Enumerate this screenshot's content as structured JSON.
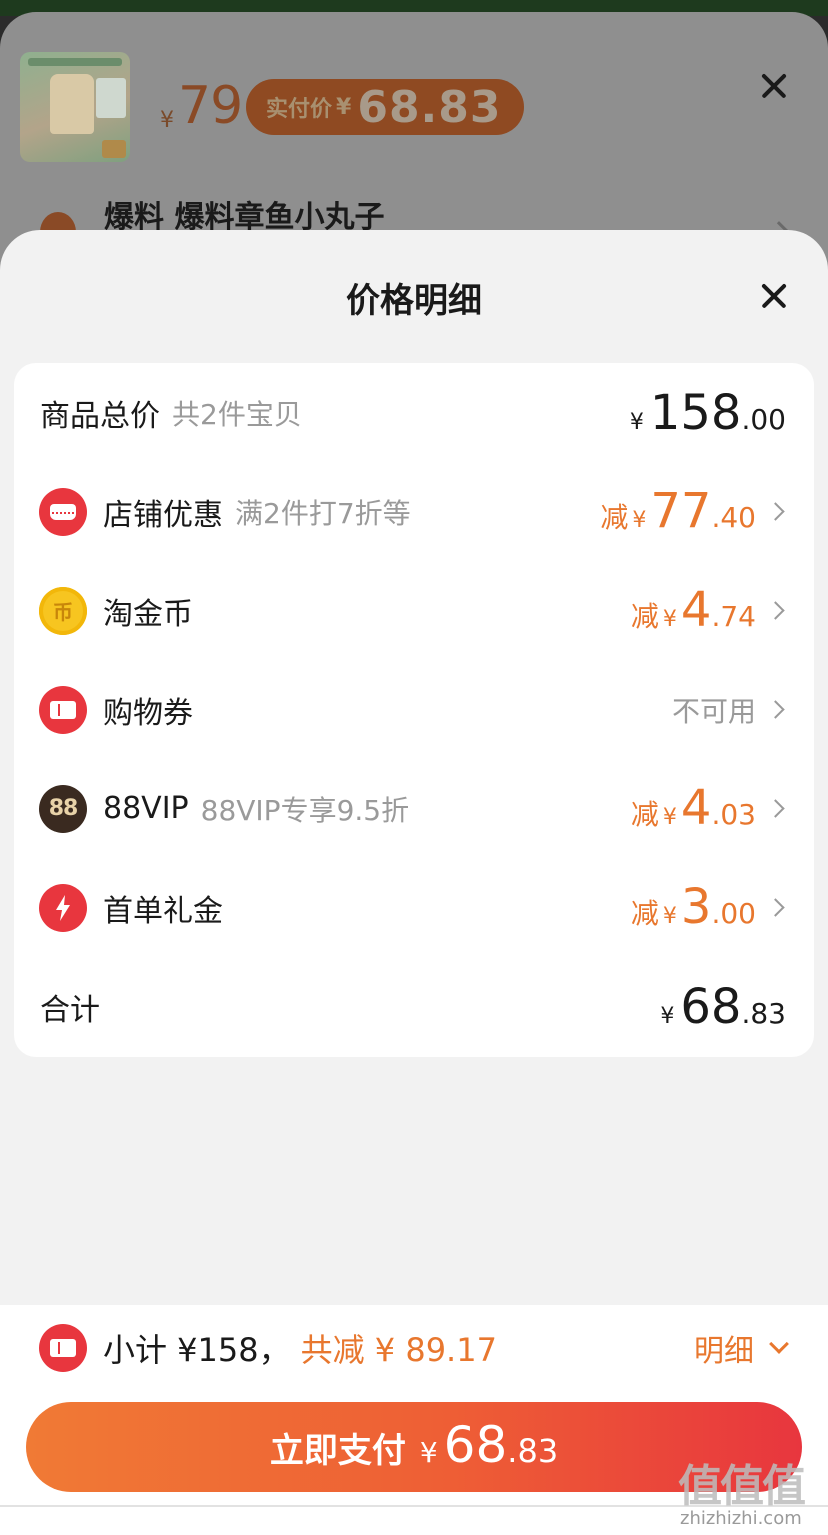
{
  "background": {
    "product_price_yen": "¥",
    "product_price": "79",
    "actual_price_label": "实付价",
    "actual_price_yen": "¥",
    "actual_price": "68.83",
    "location_text": "爆料 爆料章鱼小丸子"
  },
  "panel": {
    "title": "价格明细"
  },
  "rows": {
    "total": {
      "label": "商品总价",
      "hint": "共2件宝贝",
      "yen": "¥",
      "int": "158",
      "dec": ".00"
    },
    "shop_discount": {
      "label": "店铺优惠",
      "hint": "满2件打7折等",
      "prefix": "减",
      "yen": "¥",
      "int": "77",
      "dec": ".40"
    },
    "gold_coin": {
      "label": "淘金币",
      "prefix": "减",
      "yen": "¥",
      "int": "4",
      "dec": ".74"
    },
    "coupon": {
      "label": "购物券",
      "status": "不可用"
    },
    "vip": {
      "label": "88VIP",
      "hint": "88VIP专享9.5折",
      "badge": "88",
      "prefix": "减",
      "yen": "¥",
      "int": "4",
      "dec": ".03"
    },
    "first_order": {
      "label": "首单礼金",
      "prefix": "减",
      "yen": "¥",
      "int": "3",
      "dec": ".00"
    },
    "sum": {
      "label": "合计",
      "yen": "¥",
      "int": "68",
      "dec": ".83"
    }
  },
  "icons": {
    "shop": "shop-icon",
    "coin": "coin-icon",
    "coin_glyph": "币",
    "coupon": "ticket-icon",
    "vip": "vip-88-icon",
    "first_order": "lightning-icon"
  },
  "bottom": {
    "subtotal": "小计 ¥158，",
    "saved": "共减 ¥ 89.17",
    "detail_label": "明细",
    "pay_label": "立即支付",
    "pay_yen": "¥",
    "pay_int": "68",
    "pay_dec": ".83"
  },
  "watermark": {
    "big": "值值值",
    "small": "zhizhizhi.com"
  },
  "colors": {
    "accent_orange": "#e8772e",
    "accent_red": "#e8363e",
    "coin_gold": "#f7c520"
  }
}
